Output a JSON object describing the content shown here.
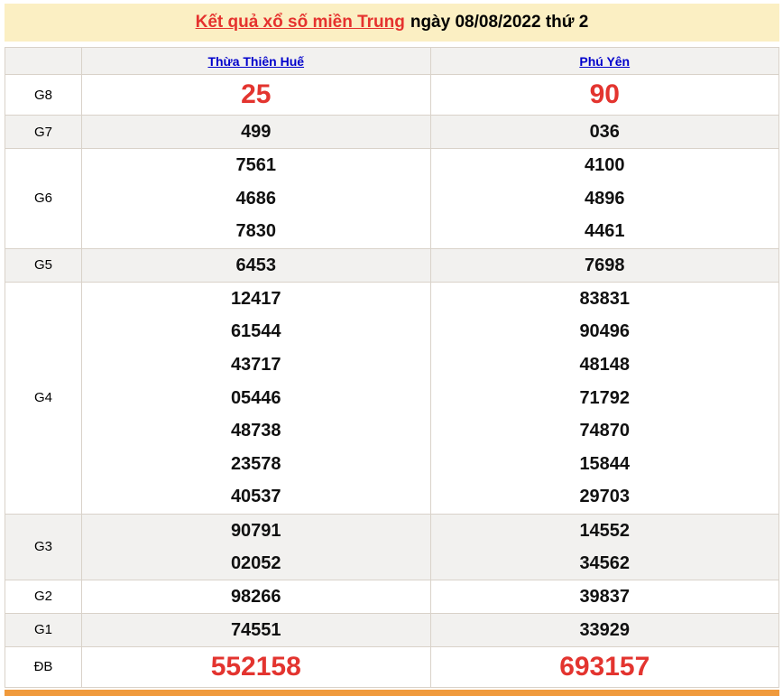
{
  "header": {
    "title_link": "Kết quả xổ số miền Trung",
    "date_text": "ngày 08/08/2022 thứ 2"
  },
  "table": {
    "corner_label": "",
    "provinces": [
      "Thừa Thiên Huế",
      "Phú Yên"
    ],
    "rows": [
      {
        "label": "G8",
        "highlight": true,
        "col1": [
          "25"
        ],
        "col2": [
          "90"
        ]
      },
      {
        "label": "G7",
        "highlight": false,
        "col1": [
          "499"
        ],
        "col2": [
          "036"
        ]
      },
      {
        "label": "G6",
        "highlight": false,
        "col1": [
          "7561",
          "4686",
          "7830"
        ],
        "col2": [
          "4100",
          "4896",
          "4461"
        ]
      },
      {
        "label": "G5",
        "highlight": false,
        "col1": [
          "6453"
        ],
        "col2": [
          "7698"
        ]
      },
      {
        "label": "G4",
        "highlight": false,
        "col1": [
          "12417",
          "61544",
          "43717",
          "05446",
          "48738",
          "23578",
          "40537"
        ],
        "col2": [
          "83831",
          "90496",
          "48148",
          "71792",
          "74870",
          "15844",
          "29703"
        ]
      },
      {
        "label": "G3",
        "highlight": false,
        "col1": [
          "90791",
          "02052"
        ],
        "col2": [
          "14552",
          "34562"
        ]
      },
      {
        "label": "G2",
        "highlight": false,
        "col1": [
          "98266"
        ],
        "col2": [
          "39837"
        ]
      },
      {
        "label": "G1",
        "highlight": false,
        "col1": [
          "74551"
        ],
        "col2": [
          "33929"
        ]
      },
      {
        "label": "ĐB",
        "highlight": true,
        "col1": [
          "552158"
        ],
        "col2": [
          "693157"
        ]
      }
    ]
  },
  "colors": {
    "title_bar_bg": "#FBEFC3",
    "accent_red": "#E3342F",
    "link_blue": "#0000CC",
    "row_shade": "#F2F1EF",
    "table_border": "#D9D2C9",
    "footer_orange": "#F09A3C"
  }
}
